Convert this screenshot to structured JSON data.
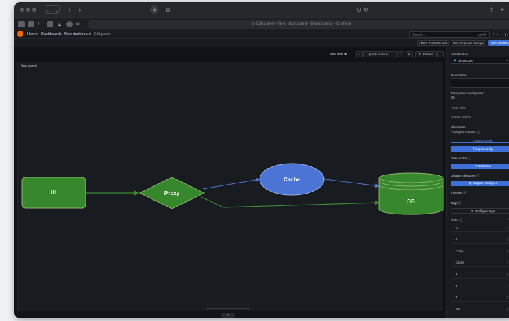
{
  "browser": {
    "url": "Edit panel - New dashboard - Dashboards - Grafana",
    "tab_icons": [
      "grafana-icon",
      "shield-icon",
      "pen-icon",
      "square-icon",
      "triangle-icon",
      "circle-icon",
      "m-icon"
    ]
  },
  "nav": {
    "breadcrumb": [
      "Home",
      "Dashboards",
      "New dashboard",
      "Edit panel"
    ],
    "search_placeholder": "Search...",
    "search_shortcut": "ctrl+k"
  },
  "actions": {
    "back": "Back to dashboard",
    "discard": "Discard panel changes",
    "save": "Save dashboard"
  },
  "toolbar": {
    "table_view": "Table view",
    "time_range": "Last 6 hours",
    "refresh": "Refresh"
  },
  "panel": {
    "title": "New panel",
    "page_indicator": "?"
  },
  "diagram": {
    "nodes": {
      "ui": "UI",
      "proxy": "Proxy",
      "cache": "Cache",
      "db": "DB"
    },
    "colors": {
      "green_fill": "#37872d",
      "green_stroke": "#8ab56a",
      "blue_fill": "#4c74d4",
      "blue_stroke": "#9cb5ec",
      "edge_green": "#3f8a33",
      "edge_blue": "#4f78d8"
    }
  },
  "sidebar": {
    "visualization_label": "Visualization",
    "visualization_value": "ShowCase",
    "description_label": "Description",
    "transparent_label": "Transparent background",
    "panel_links": "Panel links",
    "repeat_options": "Repeat options",
    "section": "ShowCase",
    "config_transfer": "Config file transfer",
    "export_config": "Export config",
    "import_config": "Import config",
    "draw_editor": "Draw editor",
    "edit_draw": "Edit draw",
    "diagram_designer": "Diagram designer",
    "diagram_designer_btn": "Diagram designer",
    "timeline": "Timeline",
    "tags": "Tags",
    "configure_tags": "Configure tags",
    "rules": "Rules",
    "rule_items": [
      "UI",
      "2",
      "Proxy",
      "Cache",
      "3",
      "5",
      "4",
      "DB"
    ]
  }
}
